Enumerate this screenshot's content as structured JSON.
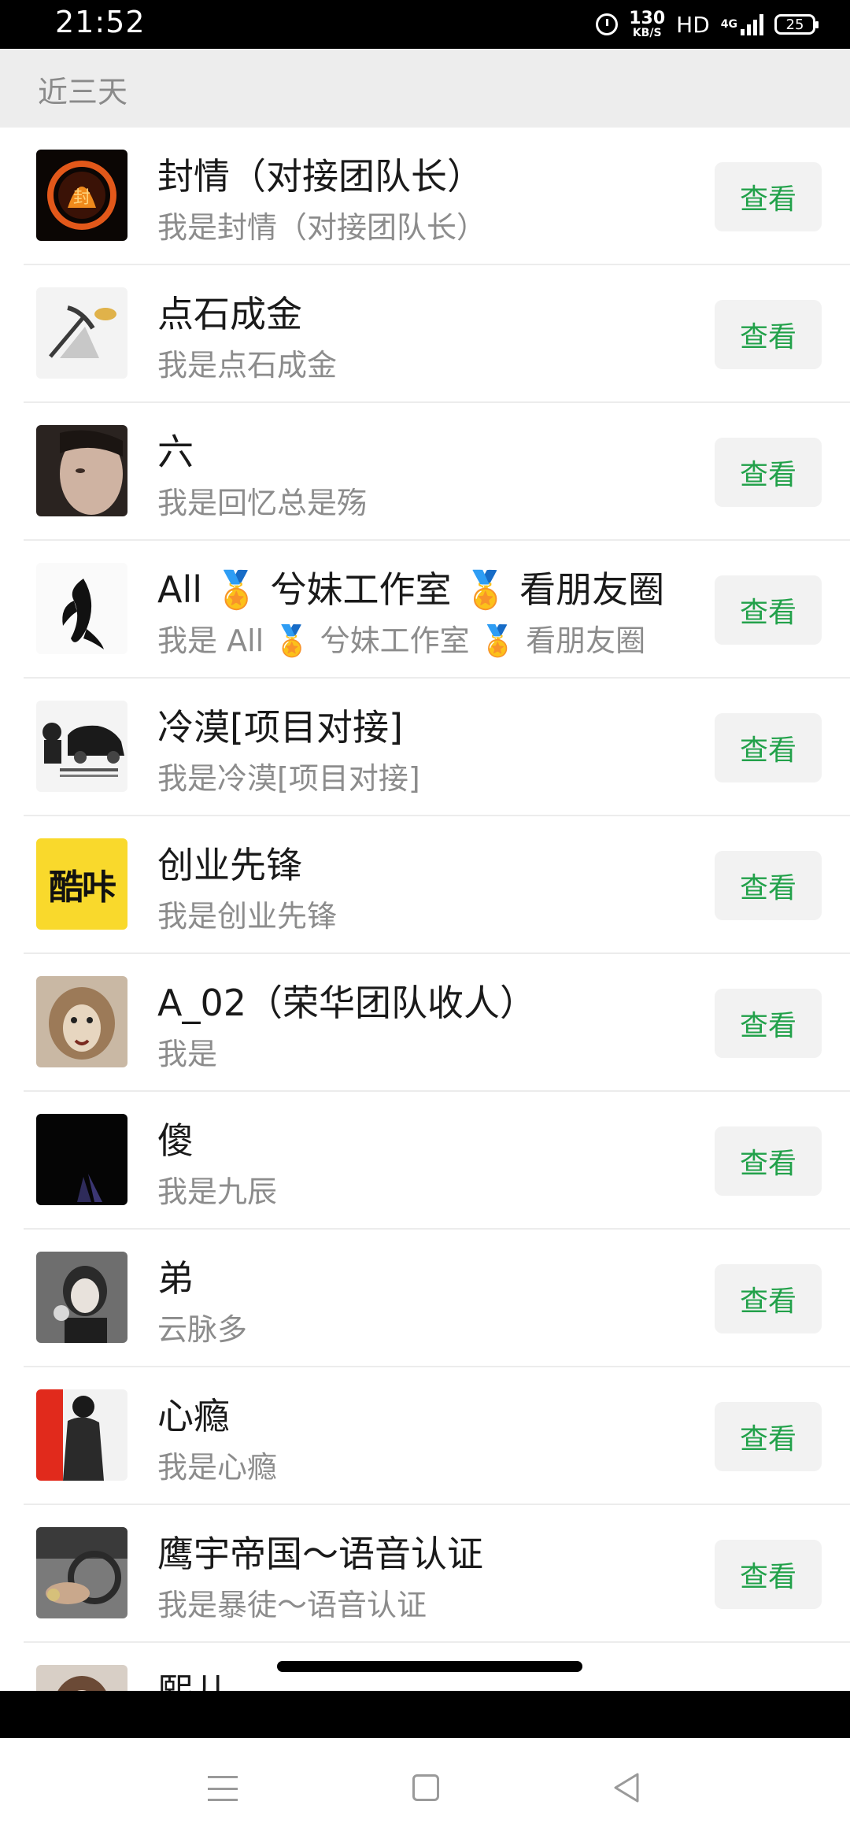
{
  "status_bar": {
    "time": "21:52",
    "speed_value": "130",
    "speed_unit": "KB/S",
    "hd_label": "HD",
    "network_label": "4G",
    "battery": "25"
  },
  "section_header": {
    "label": "近三天"
  },
  "list": {
    "button_label": "查看",
    "items": [
      {
        "name": "封情（对接团队长）",
        "message": "我是封情（对接团队长）",
        "avatar_icon": "fire-logo-avatar"
      },
      {
        "name": "点石成金",
        "message": "我是点石成金",
        "avatar_icon": "pickaxe-gold-avatar"
      },
      {
        "name": "六",
        "message": "我是回忆总是殇",
        "avatar_icon": "man-portrait-avatar"
      },
      {
        "name": "All 🏅 兮妹工作室 🏅 看朋友圈",
        "message": "我是 All 🏅 兮妹工作室 🏅 看朋友圈",
        "avatar_icon": "ink-fish-avatar"
      },
      {
        "name": "冷漠[项目对接]",
        "message": "我是冷漠[项目对接]",
        "avatar_icon": "car-avatar"
      },
      {
        "name": "创业先锋",
        "message": "我是创业先锋",
        "avatar_icon": "kuka-logo-avatar",
        "avatar_text": "酷咔"
      },
      {
        "name": "A_02（荣华团队收人）",
        "message": "我是",
        "avatar_icon": "lion-avatar"
      },
      {
        "name": "傻",
        "message": "我是九辰",
        "avatar_icon": "dark-avatar"
      },
      {
        "name": "弟",
        "message": "云脉多",
        "avatar_icon": "anime-girl-avatar"
      },
      {
        "name": "心瘾",
        "message": "我是心瘾",
        "avatar_icon": "red-wall-avatar"
      },
      {
        "name": "鹰宇帝国～语音认证",
        "message": "我是暴徒～语音认证",
        "avatar_icon": "car-interior-avatar"
      },
      {
        "name": "熙儿",
        "message": "",
        "avatar_icon": "girl-avatar"
      }
    ]
  },
  "nav_bar": {
    "menu_icon": "menu-icon",
    "home_icon": "square-home-icon",
    "back_icon": "triangle-back-icon"
  }
}
